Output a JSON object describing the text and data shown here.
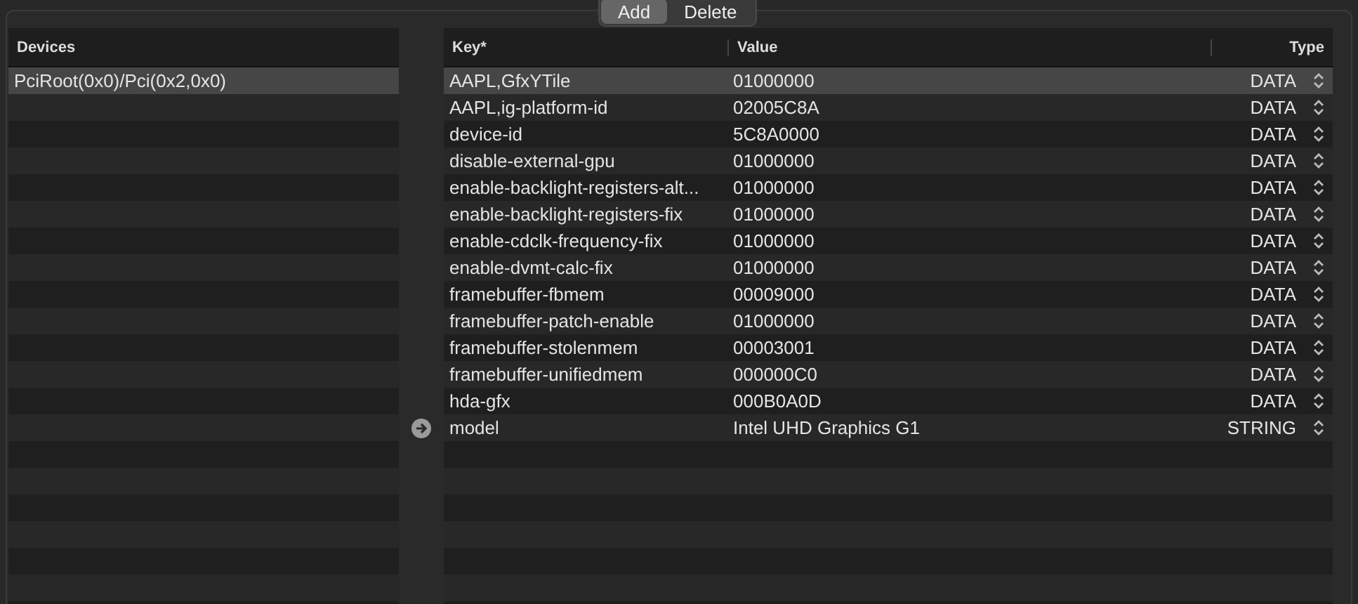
{
  "segmented": [
    {
      "label": "Add",
      "selected": true
    },
    {
      "label": "Delete",
      "selected": false
    }
  ],
  "devices": {
    "header": "Devices",
    "rows": [
      {
        "path": "PciRoot(0x0)/Pci(0x2,0x0)",
        "selected": true
      }
    ]
  },
  "properties": {
    "columns": [
      "Key*",
      "Value",
      "Type"
    ],
    "rows": [
      {
        "key": "AAPL,GfxYTile",
        "value": "01000000",
        "type": "DATA",
        "selected": true,
        "arrow": false
      },
      {
        "key": "AAPL,ig-platform-id",
        "value": "02005C8A",
        "type": "DATA",
        "selected": false,
        "arrow": false
      },
      {
        "key": "device-id",
        "value": "5C8A0000",
        "type": "DATA",
        "selected": false,
        "arrow": false
      },
      {
        "key": "disable-external-gpu",
        "value": "01000000",
        "type": "DATA",
        "selected": false,
        "arrow": false
      },
      {
        "key": "enable-backlight-registers-alt...",
        "value": "01000000",
        "type": "DATA",
        "selected": false,
        "arrow": false
      },
      {
        "key": "enable-backlight-registers-fix",
        "value": "01000000",
        "type": "DATA",
        "selected": false,
        "arrow": false
      },
      {
        "key": "enable-cdclk-frequency-fix",
        "value": "01000000",
        "type": "DATA",
        "selected": false,
        "arrow": false
      },
      {
        "key": "enable-dvmt-calc-fix",
        "value": "01000000",
        "type": "DATA",
        "selected": false,
        "arrow": false
      },
      {
        "key": "framebuffer-fbmem",
        "value": "00009000",
        "type": "DATA",
        "selected": false,
        "arrow": false
      },
      {
        "key": "framebuffer-patch-enable",
        "value": "01000000",
        "type": "DATA",
        "selected": false,
        "arrow": false
      },
      {
        "key": "framebuffer-stolenmem",
        "value": "00003001",
        "type": "DATA",
        "selected": false,
        "arrow": false
      },
      {
        "key": "framebuffer-unifiedmem",
        "value": "000000C0",
        "type": "DATA",
        "selected": false,
        "arrow": false
      },
      {
        "key": "hda-gfx",
        "value": "000B0A0D",
        "type": "DATA",
        "selected": false,
        "arrow": false
      },
      {
        "key": "model",
        "value": "Intel UHD Graphics G1",
        "type": "STRING",
        "selected": false,
        "arrow": true
      }
    ]
  }
}
